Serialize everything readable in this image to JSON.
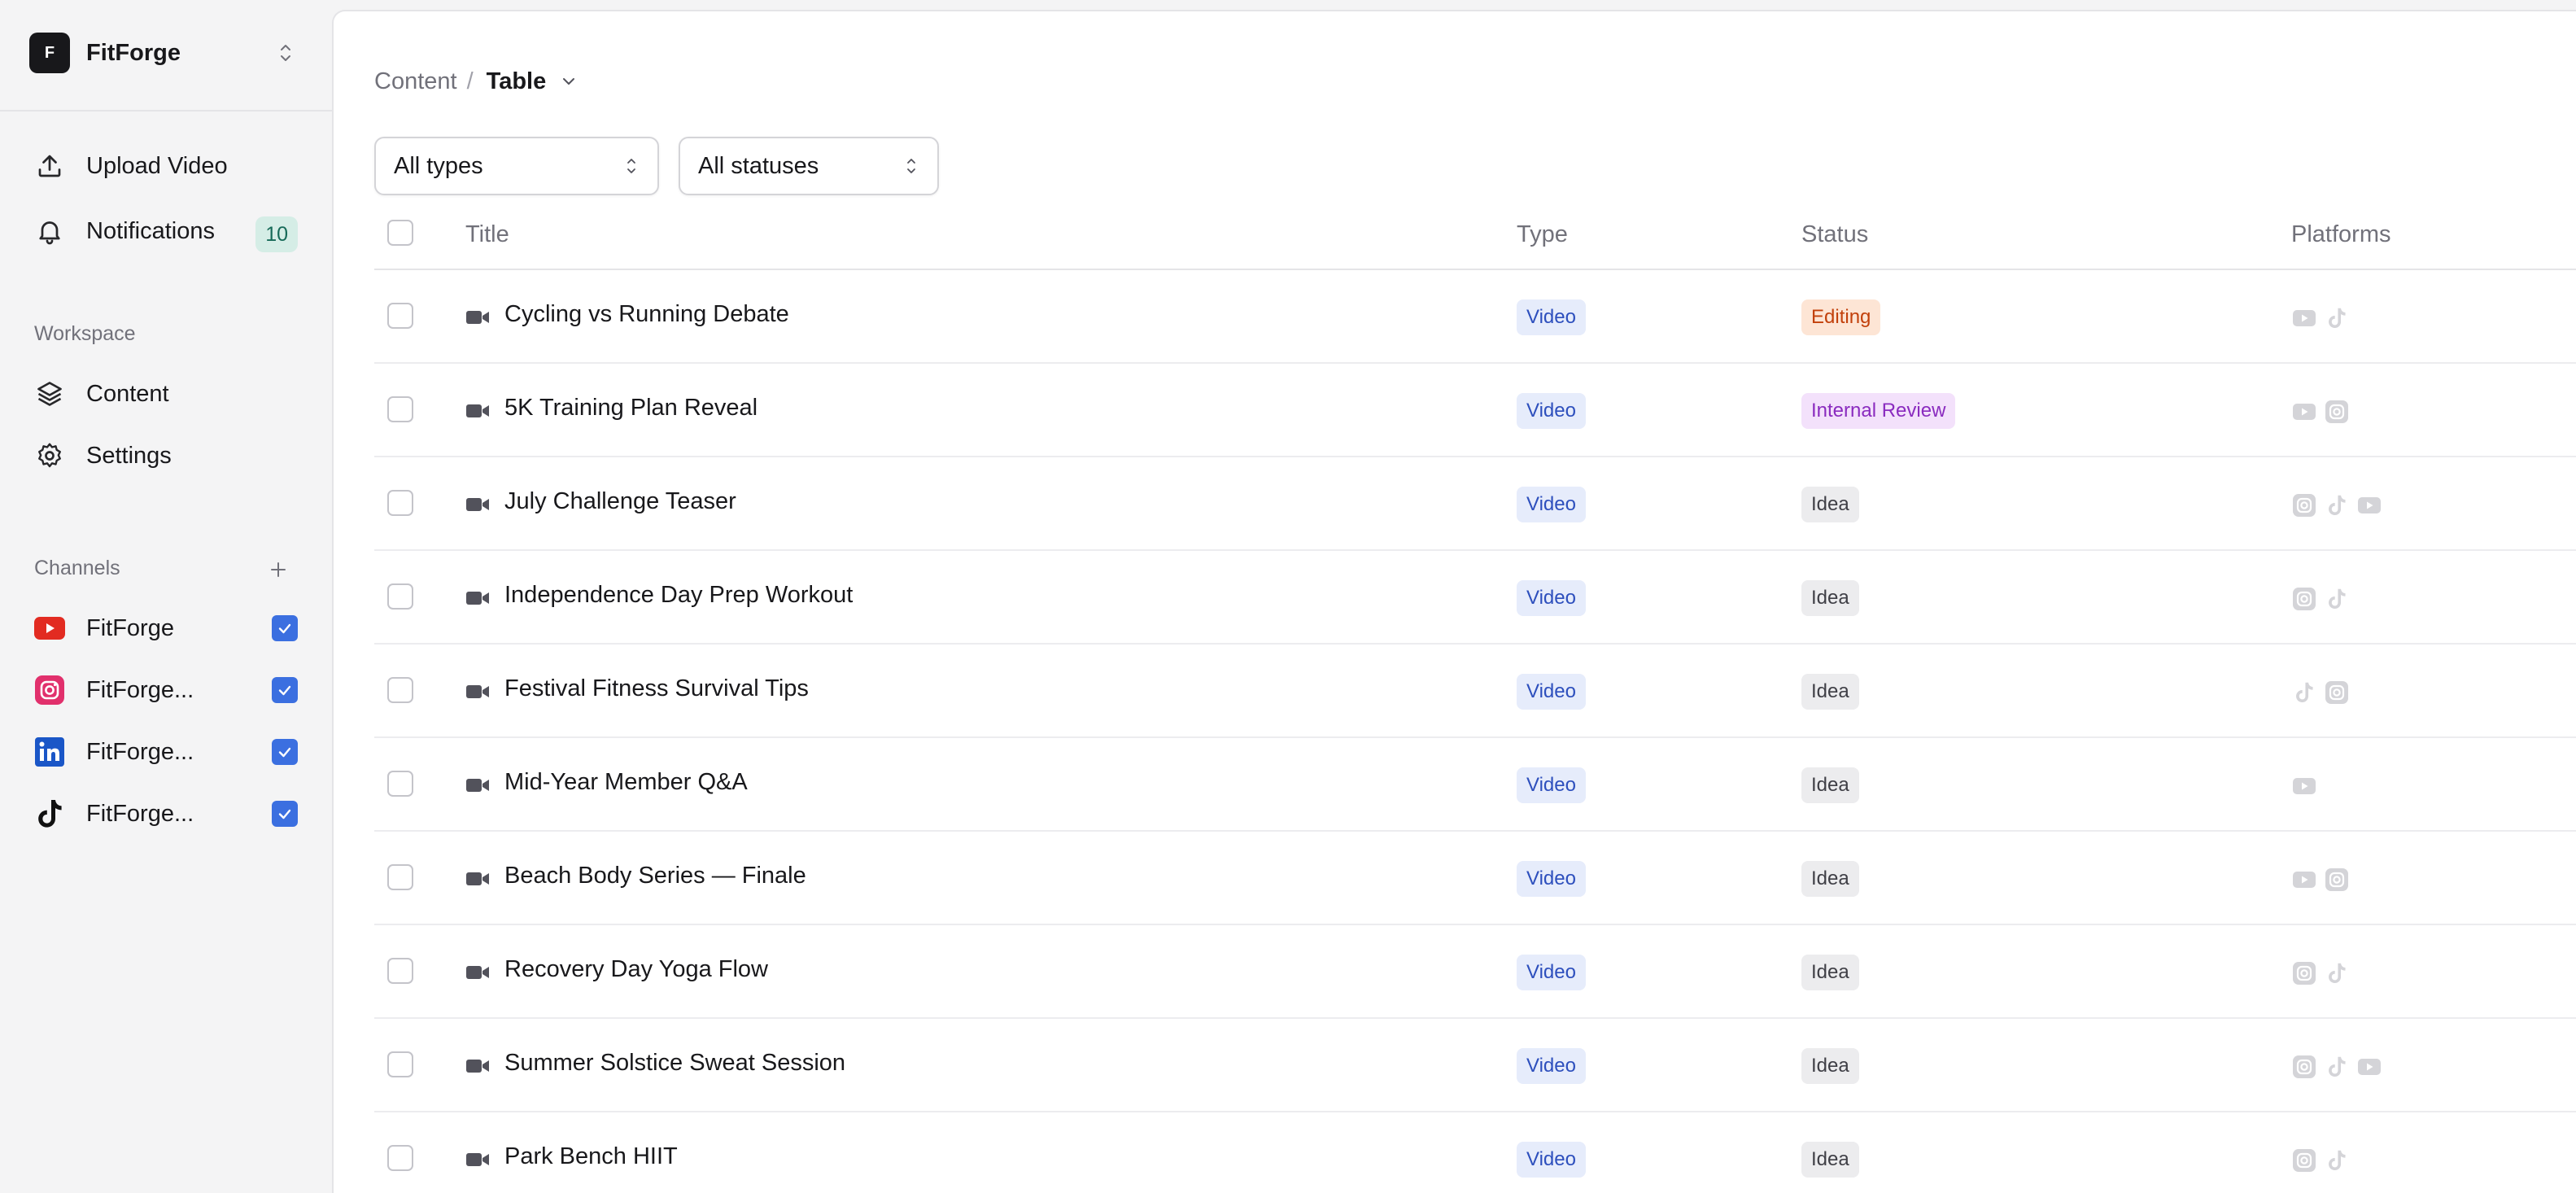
{
  "brand": {
    "initial": "F",
    "name": "FitForge"
  },
  "nav": {
    "upload_label": "Upload Video",
    "notifications_label": "Notifications",
    "notifications_count": "10"
  },
  "workspace": {
    "label": "Workspace",
    "items": [
      {
        "label": "Content",
        "icon": "layers-icon"
      },
      {
        "label": "Settings",
        "icon": "gear-icon"
      }
    ]
  },
  "channels": {
    "label": "Channels",
    "items": [
      {
        "label": "FitForge",
        "platform": "youtube",
        "checked": true
      },
      {
        "label": "FitForge...",
        "platform": "instagram",
        "checked": true
      },
      {
        "label": "FitForge...",
        "platform": "linkedin",
        "checked": true
      },
      {
        "label": "FitForge...",
        "platform": "tiktok",
        "checked": true
      }
    ]
  },
  "breadcrumb": {
    "root": "Content",
    "separator": "/",
    "current": "Table"
  },
  "filters": {
    "type_value": "All types",
    "status_value": "All statuses"
  },
  "table": {
    "columns": {
      "title": "Title",
      "type": "Type",
      "status": "Status",
      "platforms": "Platforms"
    },
    "rows": [
      {
        "title": "Cycling vs Running Debate",
        "type": "Video",
        "status": "Editing",
        "status_kind": "editing",
        "platforms": [
          "youtube",
          "tiktok"
        ]
      },
      {
        "title": "5K Training Plan Reveal",
        "type": "Video",
        "status": "Internal Review",
        "status_kind": "review",
        "platforms": [
          "youtube",
          "instagram"
        ]
      },
      {
        "title": "July Challenge Teaser",
        "type": "Video",
        "status": "Idea",
        "status_kind": "idea",
        "platforms": [
          "instagram",
          "tiktok",
          "youtube"
        ]
      },
      {
        "title": "Independence Day Prep Workout",
        "type": "Video",
        "status": "Idea",
        "status_kind": "idea",
        "platforms": [
          "instagram",
          "tiktok"
        ]
      },
      {
        "title": "Festival Fitness Survival Tips",
        "type": "Video",
        "status": "Idea",
        "status_kind": "idea",
        "platforms": [
          "tiktok",
          "instagram"
        ]
      },
      {
        "title": "Mid-Year Member Q&A",
        "type": "Video",
        "status": "Idea",
        "status_kind": "idea",
        "platforms": [
          "youtube"
        ]
      },
      {
        "title": "Beach Body Series — Finale",
        "type": "Video",
        "status": "Idea",
        "status_kind": "idea",
        "platforms": [
          "youtube",
          "instagram"
        ]
      },
      {
        "title": "Recovery Day Yoga Flow",
        "type": "Video",
        "status": "Idea",
        "status_kind": "idea",
        "platforms": [
          "instagram",
          "tiktok"
        ]
      },
      {
        "title": "Summer Solstice Sweat Session",
        "type": "Video",
        "status": "Idea",
        "status_kind": "idea",
        "platforms": [
          "instagram",
          "tiktok",
          "youtube"
        ]
      },
      {
        "title": "Park Bench HIIT",
        "type": "Video",
        "status": "Idea",
        "status_kind": "idea",
        "platforms": [
          "instagram",
          "tiktok"
        ]
      }
    ]
  },
  "colors": {
    "accent": "#3b6fe0",
    "editing_bg": "#fde5d5",
    "editing_fg": "#c2410c",
    "review_bg": "#f3e1fb",
    "review_fg": "#8a2bbf",
    "idea_bg": "#ececee",
    "idea_fg": "#3f3f46",
    "type_bg": "#e6ecfb",
    "type_fg": "#2d4fbd"
  }
}
